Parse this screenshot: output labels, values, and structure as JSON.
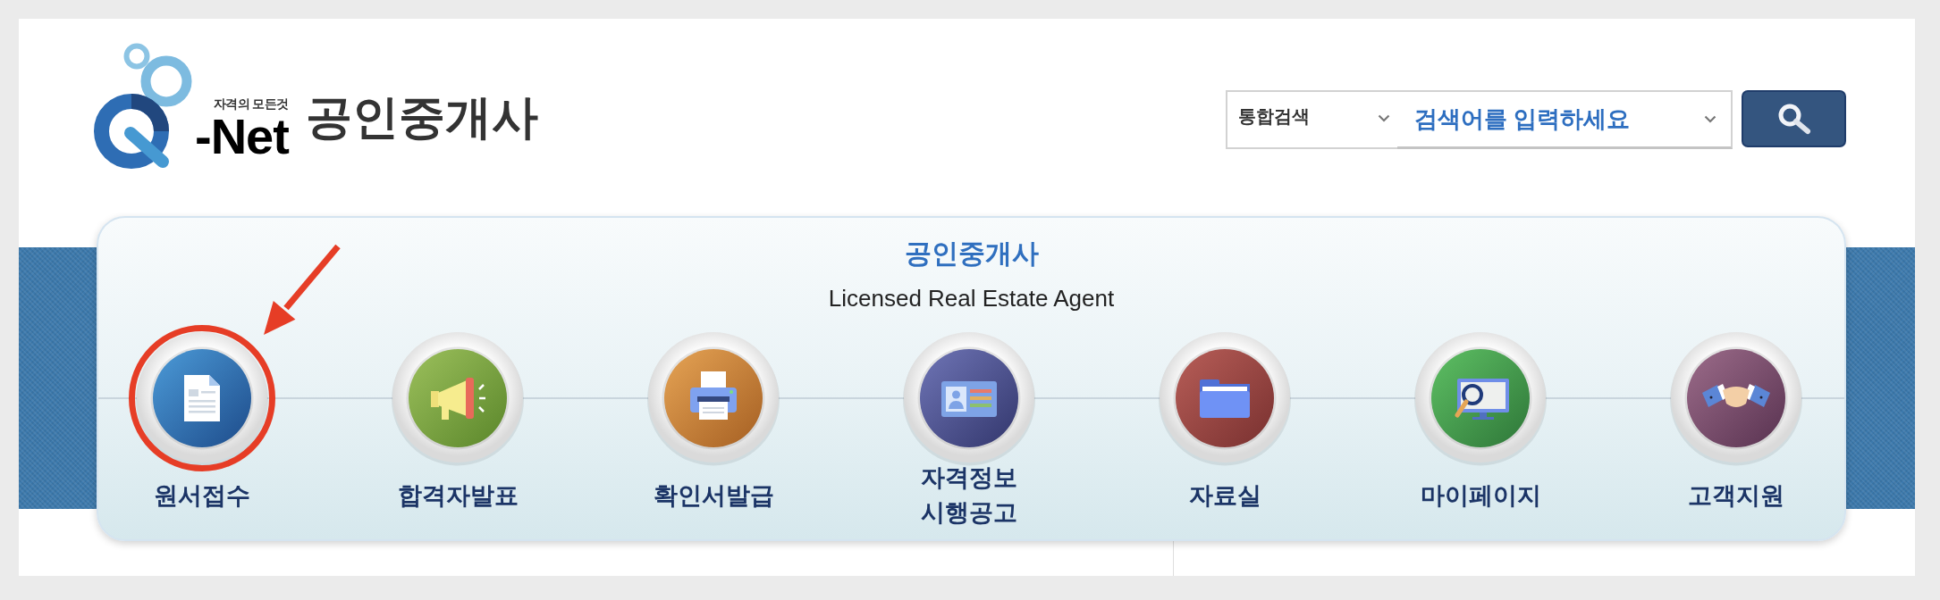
{
  "logo": {
    "tagline": "자격의 모든것",
    "wordmark": "-Net"
  },
  "page_title": "공인중개사",
  "search": {
    "scope": "통합검색",
    "placeholder": "검색어를 입력하세요"
  },
  "banner": {
    "title": "공인중개사",
    "subtitle": "Licensed Real Estate Agent"
  },
  "menu": [
    {
      "label": "원서접수",
      "highlighted": true
    },
    {
      "label": "합격자발표",
      "highlighted": false
    },
    {
      "label": "확인서발급",
      "highlighted": false
    },
    {
      "label": "자격정보 시행공고",
      "highlighted": false
    },
    {
      "label": "자료실",
      "highlighted": false
    },
    {
      "label": "마이페이지",
      "highlighted": false
    },
    {
      "label": "고객지원",
      "highlighted": false
    }
  ]
}
